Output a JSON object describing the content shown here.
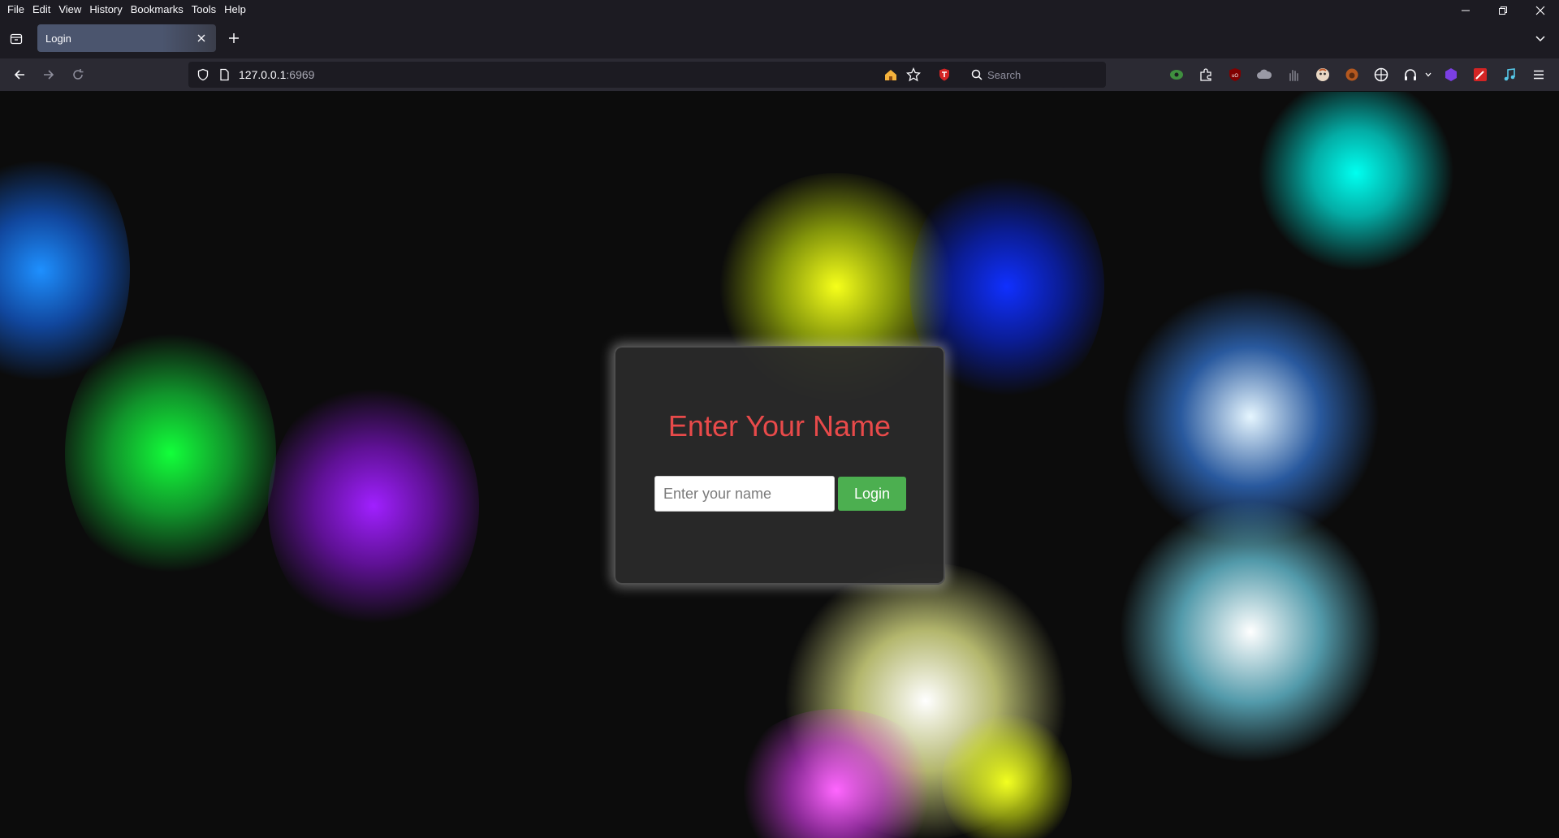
{
  "menubar": {
    "items": [
      "File",
      "Edit",
      "View",
      "History",
      "Bookmarks",
      "Tools",
      "Help"
    ]
  },
  "window_controls": {
    "minimize_icon": "minimize-icon",
    "restore_icon": "restore-icon",
    "close_icon": "close-icon"
  },
  "tabs": [
    {
      "title": "Login",
      "active": true
    }
  ],
  "navbar": {
    "url_host": "127.0.0.1",
    "url_port": ":6969",
    "search_placeholder": "Search",
    "extensions": [
      "home-icon",
      "star-icon",
      "shield-extension-icon",
      "eye-extension-icon",
      "puzzle-icon",
      "ublock-icon",
      "cloud-icon",
      "hand-icon",
      "avatar-icon",
      "fox-icon",
      "globe-icon",
      "headphones-icon",
      "hex-icon",
      "pen-icon",
      "music-icon",
      "menu-icon"
    ]
  },
  "colors": {
    "accent_red": "#e84a4a",
    "login_green": "#4caf50",
    "card_bg": "#2a2a2a"
  },
  "page": {
    "title": "Enter Your Name",
    "input_placeholder": "Enter your name",
    "input_value": "",
    "button_label": "Login"
  }
}
